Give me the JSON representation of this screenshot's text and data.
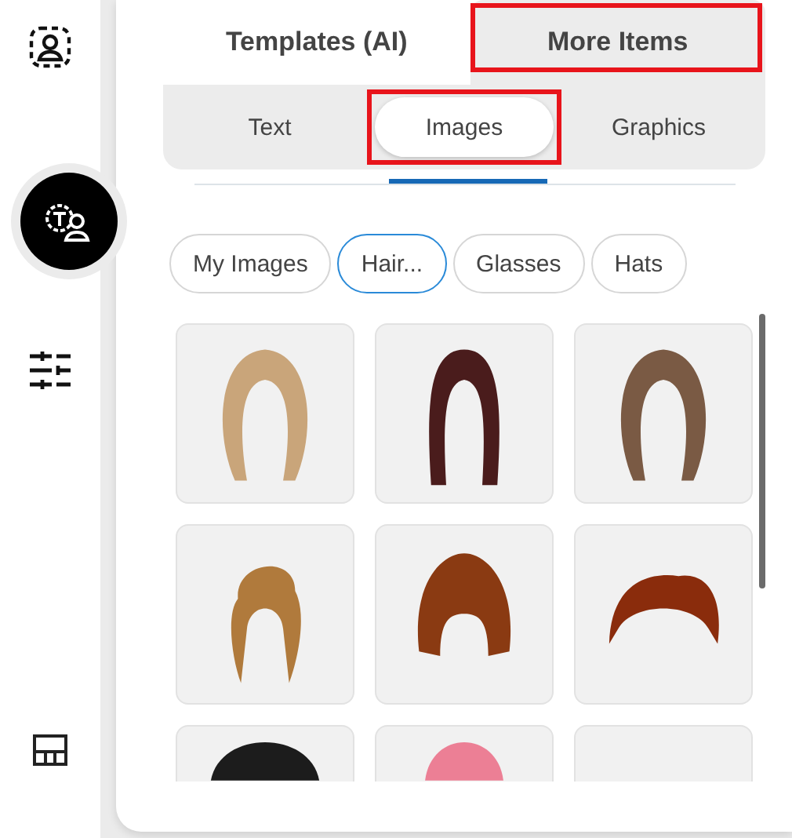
{
  "sidebar": {
    "items": [
      {
        "kind": "portrait",
        "selected": false
      },
      {
        "kind": "ai-person",
        "selected": true
      },
      {
        "kind": "sliders",
        "selected": false
      },
      {
        "kind": "layout",
        "selected": false
      }
    ]
  },
  "tabs": [
    {
      "label": "Templates (AI)",
      "selected": false,
      "highlighted": false
    },
    {
      "label": "More Items",
      "selected": true,
      "highlighted": true
    }
  ],
  "subtabs": [
    {
      "label": "Text",
      "selected": false,
      "highlighted": false
    },
    {
      "label": "Images",
      "selected": true,
      "highlighted": true
    },
    {
      "label": "Graphics",
      "selected": false,
      "highlighted": false
    }
  ],
  "categories": [
    {
      "label": "My Images",
      "selected": false
    },
    {
      "label": "Hair...",
      "selected": true
    },
    {
      "label": "Glasses",
      "selected": false
    },
    {
      "label": "Hats",
      "selected": false
    }
  ],
  "images": [
    {
      "kind": "hair",
      "color": "#c9a57a"
    },
    {
      "kind": "hair",
      "color": "#4a1c1c"
    },
    {
      "kind": "hair",
      "color": "#7a5a44"
    },
    {
      "kind": "hair",
      "color": "#b07a3c"
    },
    {
      "kind": "hair",
      "color": "#8a3a12"
    },
    {
      "kind": "hair",
      "color": "#8a2c0c"
    },
    {
      "kind": "hair",
      "color": "#1c1c1c"
    },
    {
      "kind": "hair",
      "color": "#ec7f95"
    },
    {
      "kind": "empty"
    }
  ]
}
